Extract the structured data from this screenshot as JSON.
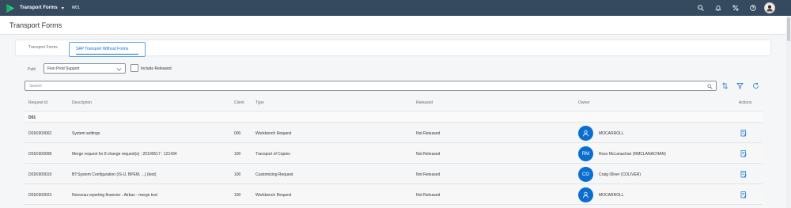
{
  "shell": {
    "app_title": "Transport Forms",
    "system": "W01",
    "icons": [
      "search-icon",
      "bell-icon",
      "percent-icon",
      "help-icon",
      "user-avatar"
    ]
  },
  "page": {
    "title": "Transport Forms"
  },
  "tabs": [
    {
      "label": "Transport Forms",
      "selected": false
    },
    {
      "label": "SAP Transport Without Forms",
      "selected": true
    }
  ],
  "filters": {
    "path_label": "Path",
    "path_value": "Fiori Prod Support",
    "include_released_label": "Include Released",
    "include_released_checked": false,
    "search_placeholder": "Search"
  },
  "table": {
    "columns": [
      "Request Id",
      "Description",
      "Client",
      "Type",
      "Released",
      "Owner",
      "Actions"
    ],
    "group": "D01",
    "rows": [
      {
        "id": "D01K900002",
        "description": "System settings",
        "client": "000",
        "type": "Workbench Request",
        "released": "Not Released",
        "owner_initials": "",
        "owner": "MOCARROLL"
      },
      {
        "id": "D01K900008",
        "description": "Merge request for 8 change request(s) : 20100617 : 121434",
        "client": "100",
        "type": "Transport of Copies",
        "released": "Not Released",
        "owner_initials": "RM",
        "owner": "Ross McLanachan (RMCLANACHAN)"
      },
      {
        "id": "D01K900019",
        "description": "BT:System Configuration (IS-U, BPEM, ...) (test)",
        "client": "100",
        "type": "Customizing Request",
        "released": "Not Released",
        "owner_initials": "CO",
        "owner": "Craig Oliver (COLIVER)"
      },
      {
        "id": "D01K900023",
        "description": "Nouveau reporting financier - Airbus - merge test",
        "client": "100",
        "type": "Workbench Request",
        "released": "Not Released",
        "owner_initials": "",
        "owner": "MOCARROLL"
      }
    ]
  },
  "colors": {
    "shell": "#354a5f",
    "accent": "#0a6ed1",
    "background": "#f5f6f7"
  }
}
